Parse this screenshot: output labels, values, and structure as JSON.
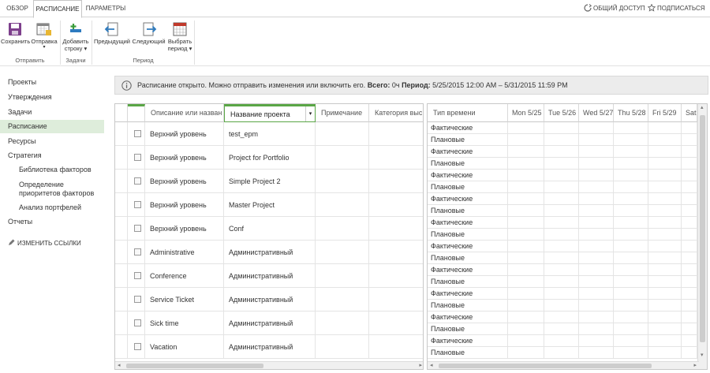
{
  "tabs": {
    "overview": "ОБЗОР",
    "schedule": "РАСПИСАНИЕ",
    "options": "ПАРАМЕТРЫ",
    "share": "ОБЩИЙ ДОСТУП",
    "follow": "ПОДПИСАТЬСЯ"
  },
  "ribbon": {
    "save": "Сохранить",
    "send": "Отправка",
    "add_row_1": "Добавить",
    "add_row_2": "строку",
    "previous": "Предыдущий",
    "next": "Следующий",
    "select_period_1": "Выбрать",
    "select_period_2": "период",
    "group_send": "Отправить",
    "group_tasks": "Задачи",
    "group_period": "Период"
  },
  "nav": {
    "projects": "Проекты",
    "approvals": "Утверждения",
    "tasks": "Задачи",
    "schedule": "Расписание",
    "resources": "Ресурсы",
    "strategy": "Стратегия",
    "factor_library": "Библиотека факторов",
    "factor_priorities_1": "Определение",
    "factor_priorities_2": "приоритетов факторов",
    "portfolio_analysis": "Анализ портфелей",
    "reports": "Отчеты",
    "edit_links": "ИЗМЕНИТЬ ССЫЛКИ"
  },
  "status": {
    "message": "Расписание открыто. Можно отправить изменения или включить его.",
    "total_label": "Всего:",
    "total_value": "0ч",
    "period_label": "Период:",
    "period_value": "5/25/2015 12:00 AM – 5/31/2015 11:59 PM"
  },
  "grid": {
    "columns": {
      "description": "Описание или назван",
      "project": "Название проекта",
      "note": "Примечание",
      "category": "Категория выс"
    },
    "rows": [
      {
        "description": "Верхний уровень",
        "project": "test_epm"
      },
      {
        "description": "Верхний уровень",
        "project": "Project for Portfolio"
      },
      {
        "description": "Верхний уровень",
        "project": "Simple Project 2"
      },
      {
        "description": "Верхний уровень",
        "project": "Master Project"
      },
      {
        "description": "Верхний уровень",
        "project": "Conf"
      },
      {
        "description": "Administrative",
        "project": "Административный"
      },
      {
        "description": "Conference",
        "project": "Административный"
      },
      {
        "description": "Service Ticket",
        "project": "Административный"
      },
      {
        "description": "Sick time",
        "project": "Административный"
      },
      {
        "description": "Vacation",
        "project": "Административный"
      }
    ]
  },
  "timegrid": {
    "time_type_header": "Тип времени",
    "days": [
      "Mon 5/25",
      "Tue 5/26",
      "Wed 5/27",
      "Thu 5/28",
      "Fri 5/29",
      "Sat"
    ],
    "actual": "Фактические",
    "planned": "Плановые"
  },
  "colors": {
    "accent_green": "#5aa646",
    "nav_selected_bg": "#deeddb",
    "status_bg": "#ececec"
  }
}
